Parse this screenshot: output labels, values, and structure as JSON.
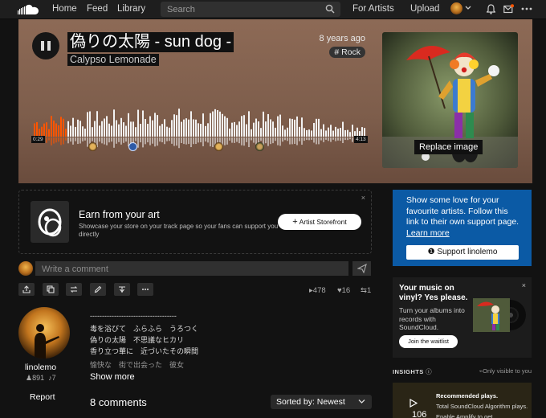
{
  "nav": {
    "links": [
      "Home",
      "Feed",
      "Library"
    ],
    "search_placeholder": "Search",
    "for_artists": "For Artists",
    "upload": "Upload"
  },
  "track": {
    "title": "偽りの太陽 - sun dog -",
    "artist": "Calypso Lemonade",
    "age": "8 years ago",
    "genre": "# Rock",
    "time_current": "0:29",
    "time_total": "4:13",
    "progress": 0.1,
    "replace_image_label": "Replace image"
  },
  "earn": {
    "title": "Earn from your art",
    "description": "Showcase your store on your track page so your fans can support you directly",
    "button_label": "Artist Storefront",
    "close": "×"
  },
  "comment_box": {
    "placeholder": "Write a comment"
  },
  "stats": {
    "plays": "478",
    "likes": "16",
    "reposts": "1"
  },
  "artist_profile": {
    "name": "linolemo",
    "followers": "891",
    "tracks": "7",
    "report_label": "Report"
  },
  "description": {
    "lines": [
      "------------------------------------",
      "毒を浴びて　ふらふら　うろつく",
      "偽りの太陽　不思議なヒカリ",
      "香り立つ華に　近づいたその瞬間",
      "愉快な　街で出会った　彼女"
    ],
    "show_more": "Show more"
  },
  "comments": {
    "count_label": "8 comments",
    "sort_label": "Sorted by: Newest"
  },
  "support": {
    "text_main": "Show some love for your favourite artists. Follow this link to their own support page.",
    "learn_more": "Learn more",
    "button_label": "Support linolemo"
  },
  "vinyl": {
    "title": "Your music on vinyl? Yes please.",
    "description": "Turn your albums into records with SoundCloud.",
    "button_label": "Join the waitlist",
    "close": "×"
  },
  "insights": {
    "label": "INSIGHTS",
    "note": "Only visible to you",
    "recommended_plays": "106",
    "rec_title": "Recommended plays.",
    "rec_text": "Total SoundCloud Algorithm plays. Enable Amplify to get"
  },
  "colors": {
    "accent_orange": "#ff5500",
    "support_blue": "#0b5aa5",
    "hero_bg": "#8d6a56"
  }
}
